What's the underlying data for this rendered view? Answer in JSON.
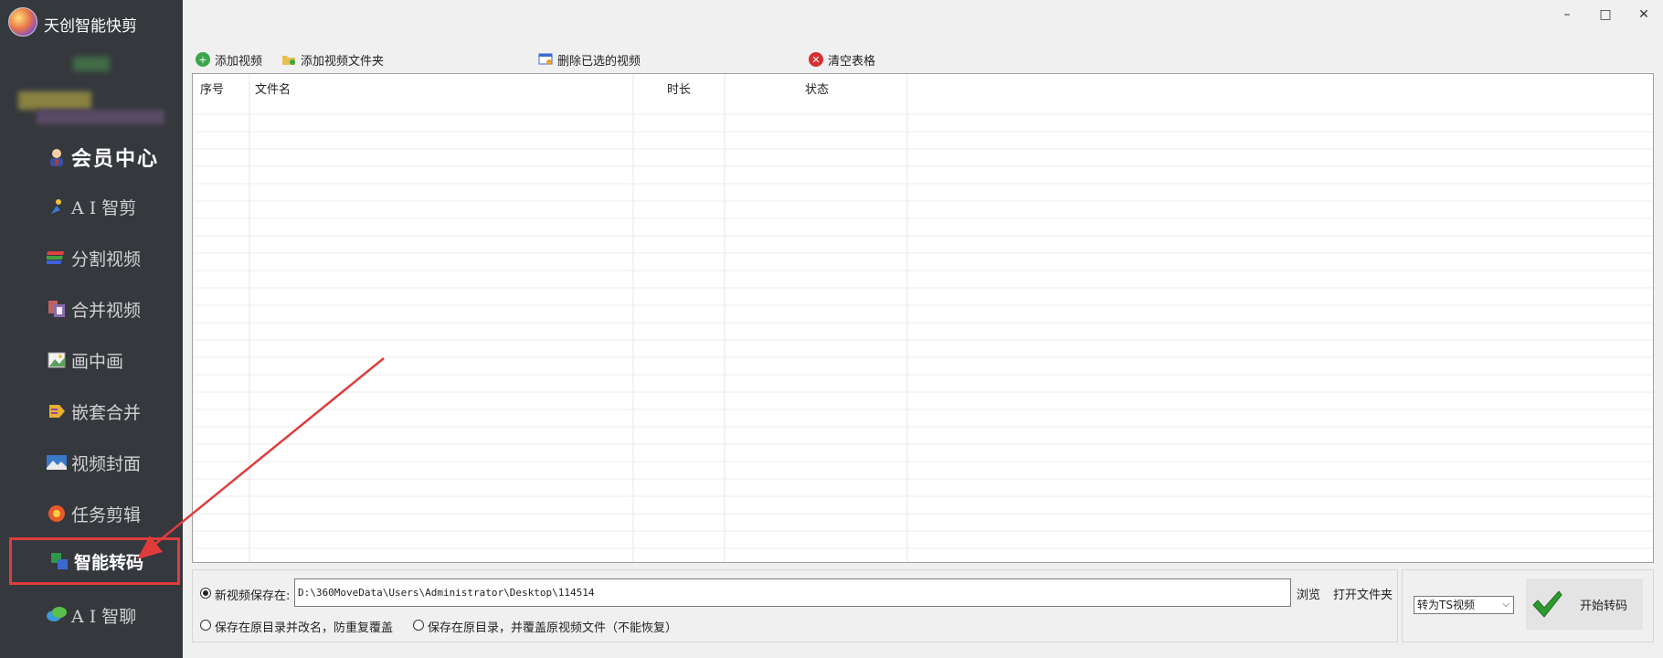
{
  "app": {
    "title": "天创智能快剪"
  },
  "sidebar": {
    "member_label": "会员中心",
    "items": [
      {
        "label": "A I 智剪",
        "icon": "person-scissor-icon"
      },
      {
        "label": "分割视频",
        "icon": "stack-layers-icon"
      },
      {
        "label": "合并视频",
        "icon": "merge-frames-icon"
      },
      {
        "label": "画中画",
        "icon": "picture-in-picture-icon"
      },
      {
        "label": "嵌套合并",
        "icon": "nested-tag-icon"
      },
      {
        "label": "视频封面",
        "icon": "landscape-image-icon"
      },
      {
        "label": "任务剪辑",
        "icon": "flower-gear-icon"
      },
      {
        "label": "智能转码",
        "icon": "transcode-icon",
        "active": true
      },
      {
        "label": "A I 智聊",
        "icon": "chat-bubbles-icon"
      }
    ]
  },
  "window_controls": {
    "minimize": "–",
    "maximize": "□",
    "close": "✕"
  },
  "toolbar": {
    "add_video": "添加视频",
    "add_folder": "添加视频文件夹",
    "delete_selected": "删除已选的视频",
    "clear_table": "清空表格"
  },
  "table": {
    "columns": [
      "序号",
      "文件名",
      "时长",
      "状态"
    ],
    "rows": []
  },
  "save_options": {
    "new_location_label": "新视频保存在:",
    "path": "D:\\360MoveData\\Users\\Administrator\\Desktop\\114514",
    "browse": "浏览",
    "open_folder": "打开文件夹",
    "rename_in_place": "保存在原目录并改名，防重复覆盖",
    "overwrite_in_place": "保存在原目录，并覆盖原视频文件（不能恢复）"
  },
  "convert": {
    "format": "转为TS视频",
    "start": "开始转码"
  },
  "colors": {
    "sidebar_bg": "#35383d",
    "highlight": "#e03c3c",
    "check_green": "#2e9a2e"
  }
}
